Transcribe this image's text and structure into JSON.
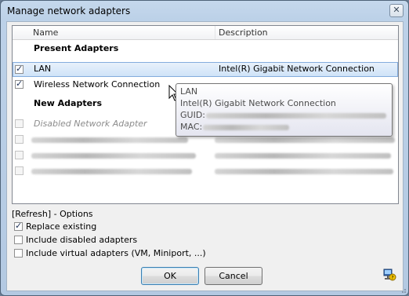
{
  "window": {
    "title": "Manage network adapters"
  },
  "list": {
    "columns": {
      "name": "Name",
      "description": "Description"
    },
    "groups": {
      "present": "Present Adapters",
      "new": "New Adapters"
    },
    "present": [
      {
        "name": "LAN",
        "description": "Intel(R) Gigabit Network Connection",
        "checked": true,
        "selected": true
      },
      {
        "name": "Wireless Network Connection",
        "description": "",
        "checked": true,
        "selected": false
      }
    ],
    "new": [
      {
        "name": "Disabled Network Adapter",
        "checked": false,
        "disabled": true
      }
    ]
  },
  "tooltip": {
    "line1": "LAN",
    "line2": "Intel(R) Gigabit Network Connection",
    "guid_label": "GUID:",
    "mac_label": "MAC:"
  },
  "options": {
    "title": "[Refresh] - Options",
    "items": [
      {
        "label": "Replace existing",
        "checked": true
      },
      {
        "label": "Include disabled adapters",
        "checked": false
      },
      {
        "label": "Include virtual adapters (VM, Miniport, ...)",
        "checked": false
      }
    ]
  },
  "buttons": {
    "ok": "OK",
    "cancel": "Cancel"
  },
  "icons": {
    "close": "close-icon",
    "help": "help-icon",
    "cursor": "mouse-pointer-icon",
    "grip": "resize-grip-icon"
  }
}
